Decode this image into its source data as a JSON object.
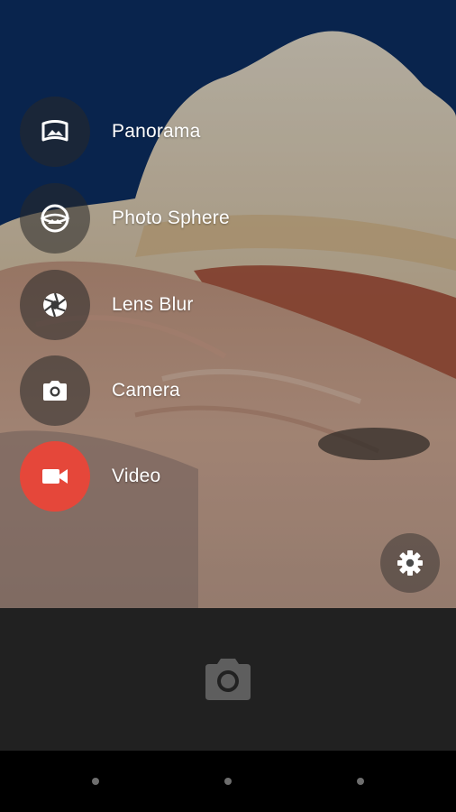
{
  "modes": [
    {
      "id": "panorama",
      "label": "Panorama",
      "icon": "panorama-icon",
      "active": false
    },
    {
      "id": "photo-sphere",
      "label": "Photo Sphere",
      "icon": "photo-sphere-icon",
      "active": false
    },
    {
      "id": "lens-blur",
      "label": "Lens Blur",
      "icon": "lens-blur-icon",
      "active": false
    },
    {
      "id": "camera",
      "label": "Camera",
      "icon": "camera-icon",
      "active": false
    },
    {
      "id": "video",
      "label": "Video",
      "icon": "video-icon",
      "active": true
    }
  ],
  "settings": {
    "icon": "gear-icon"
  },
  "shutter": {
    "icon": "camera-icon"
  },
  "nav_bar": {
    "items": [
      "back-dot",
      "home-dot",
      "recents-dot"
    ]
  },
  "colors": {
    "active_mode": "#e5473a",
    "bottom_bar": "#212121",
    "nav_bar": "#000000"
  }
}
